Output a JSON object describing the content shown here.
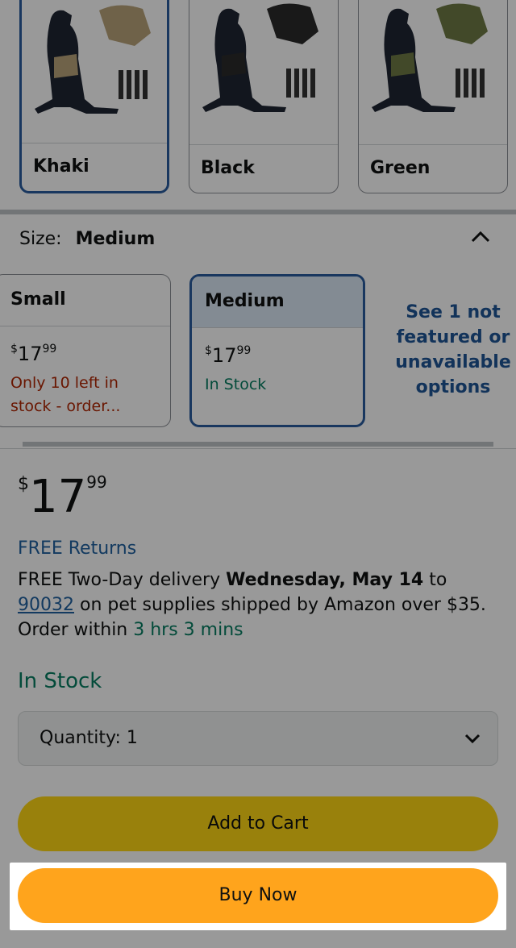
{
  "colors": {
    "options": [
      {
        "label": "Khaki",
        "harness_color": "#b9a37a",
        "selected": true
      },
      {
        "label": "Black",
        "harness_color": "#2b2b2b",
        "selected": false
      },
      {
        "label": "Green",
        "harness_color": "#6f7a45",
        "selected": false
      }
    ]
  },
  "size": {
    "label": "Size:",
    "value": "Medium",
    "options": [
      {
        "name": "Small",
        "price_symbol": "$",
        "price_whole": "17",
        "price_fraction": "99",
        "availability": "Only 10 left in stock - order...",
        "availability_status": "low"
      },
      {
        "name": "Medium",
        "price_symbol": "$",
        "price_whole": "17",
        "price_fraction": "99",
        "availability": "In Stock",
        "availability_status": "in-stock"
      }
    ],
    "more_options": "See 1 not featured or unavailable options"
  },
  "buybox": {
    "price_symbol": "$",
    "price_whole": "17",
    "price_fraction": "99",
    "free_returns": "FREE Returns",
    "delivery_prefix": "FREE Two-Day delivery",
    "delivery_date": "Wednesday, May 14",
    "delivery_to": "to",
    "zip": "90032",
    "delivery_suffix": "on pet supplies shipped by Amazon over $35.",
    "order_within_prefix": "Order within",
    "order_within_time": "3 hrs 3 mins",
    "stock": "In Stock",
    "quantity_label": "Quantity: 1",
    "add_to_cart": "Add to Cart",
    "buy_now": "Buy Now"
  },
  "theme": {
    "selected_border": "#2a5d9e",
    "link": "#2162a1",
    "in_stock": "#067d62",
    "low_stock": "#b12704",
    "add_to_cart": "#ffd814",
    "buy_now": "#ffa41c"
  }
}
